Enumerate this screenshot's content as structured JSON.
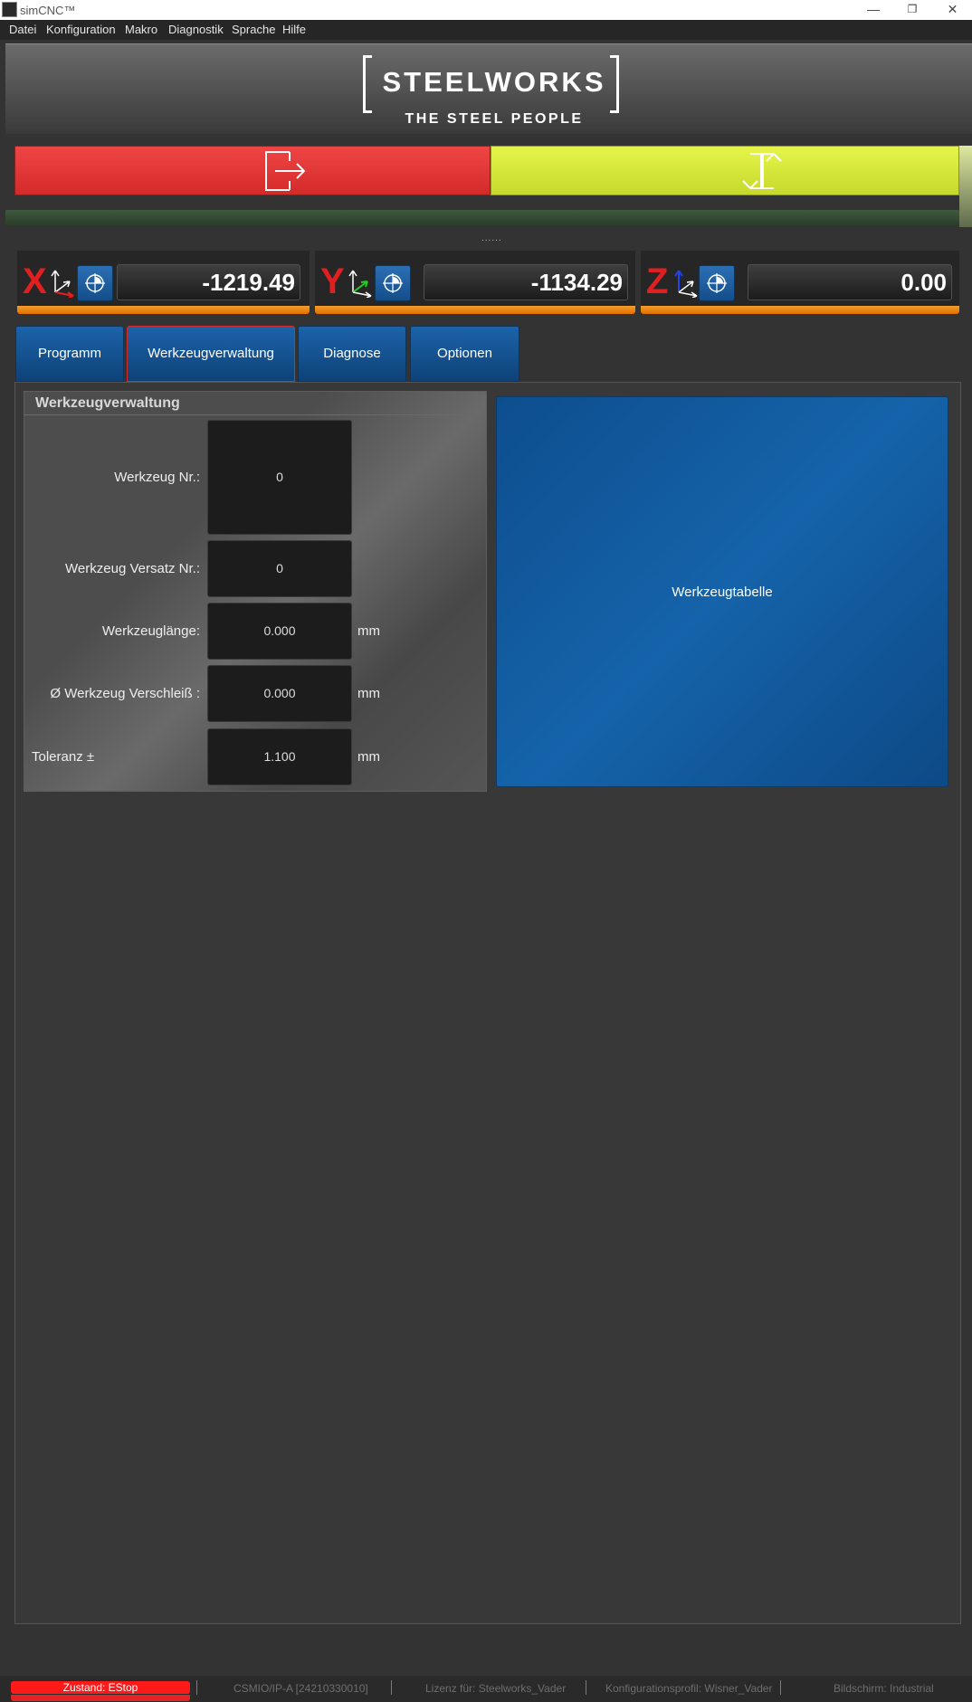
{
  "window": {
    "title": "simCNC™",
    "minimize": "—",
    "restore": "❐",
    "close": "✕"
  },
  "menu": [
    "Datei",
    "Konfiguration",
    "Makro",
    "Diagnostik",
    "Sprache",
    "Hilfe"
  ],
  "logo": {
    "main": "STEELWORKS",
    "sub": "THE STEEL PEOPLE"
  },
  "actions": {
    "exit_icon": "exit-icon",
    "swap_icon": "swap-arrows-icon"
  },
  "colors": {
    "accent_blue": "#1563aa",
    "estop_red": "#ff1a1a",
    "axis_red": "#e02020",
    "dro_orange": "#f49d2c",
    "green_button": "#d6e83a"
  },
  "separator_dots": "......",
  "axes": [
    {
      "letter": "X",
      "value": "-1219.49"
    },
    {
      "letter": "Y",
      "value": "-1134.29"
    },
    {
      "letter": "Z",
      "value": "0.00"
    }
  ],
  "tabs": [
    {
      "label": "Programm",
      "active": false
    },
    {
      "label": "Werkzeugverwaltung",
      "active": true
    },
    {
      "label": "Diagnose",
      "active": false
    },
    {
      "label": "Optionen",
      "active": false
    }
  ],
  "tool": {
    "title": "Werkzeugverwaltung",
    "fields": [
      {
        "label": "Werkzeug Nr.:",
        "value": "0",
        "unit": ""
      },
      {
        "label": "Werkzeug Versatz Nr.:",
        "value": "0",
        "unit": ""
      },
      {
        "label": "Werkzeuglänge:",
        "value": "0.000",
        "unit": "mm"
      },
      {
        "label": "Ø Werkzeug Verschleiß :",
        "value": "0.000",
        "unit": "mm"
      },
      {
        "label": "Toleranz ±",
        "value": "1.100",
        "unit": "mm"
      }
    ],
    "table_button": "Werkzeugtabelle"
  },
  "status": {
    "state": "Zustand: EStop",
    "device": "CSMIO/IP-A [24210330010]",
    "license": "Lizenz für: Steelworks_Vader",
    "profile": "Konfigurationsprofil: Wisner_Vader",
    "screen": "Bildschirm: Industrial"
  }
}
